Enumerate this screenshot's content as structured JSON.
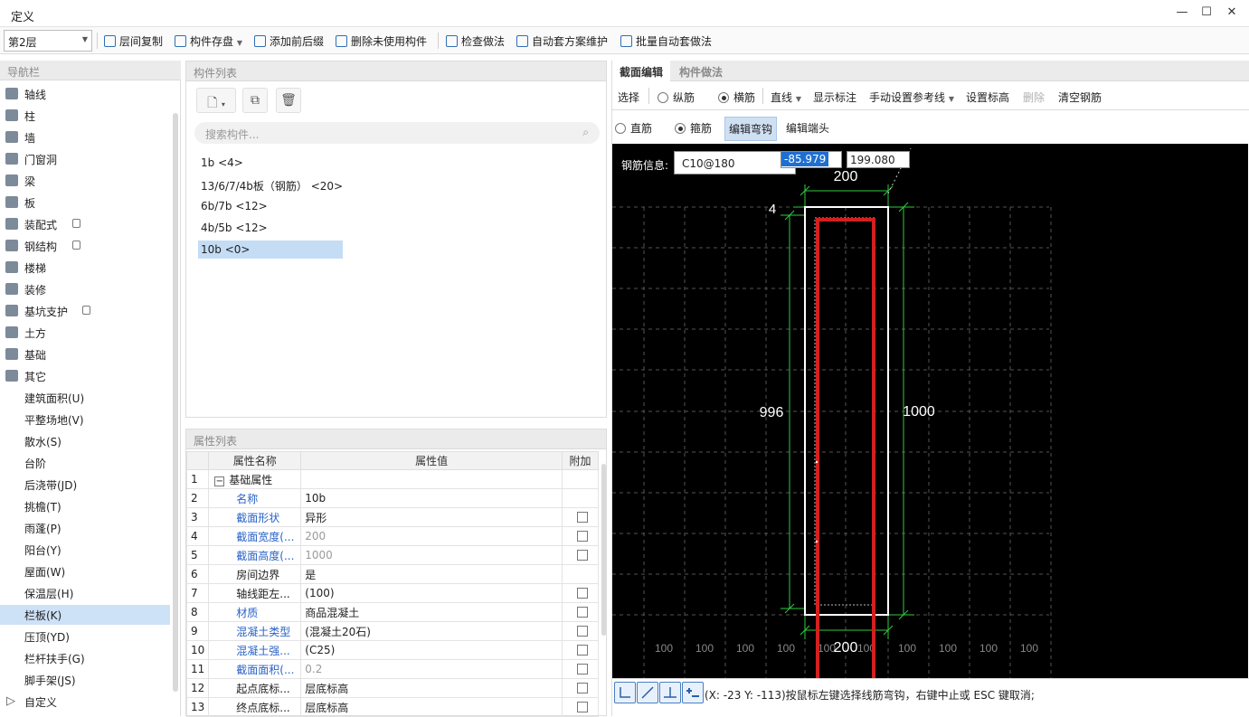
{
  "window": {
    "title": "定义"
  },
  "toolbar": {
    "floor": "第2层",
    "items": [
      "层间复制",
      "构件存盘",
      "添加前后缀",
      "删除未使用构件",
      "检查做法",
      "自动套方案维护",
      "批量自动套做法"
    ]
  },
  "nav": {
    "title": "导航栏",
    "items": [
      "轴线",
      "柱",
      "墙",
      "门窗洞",
      "梁",
      "板",
      "装配式",
      "钢结构",
      "楼梯",
      "装修",
      "基坑支护",
      "土方",
      "基础",
      "其它"
    ],
    "subitems": [
      "建筑面积(U)",
      "平整场地(V)",
      "散水(S)",
      "台阶",
      "后浇带(JD)",
      "挑檐(T)",
      "雨蓬(P)",
      "阳台(Y)",
      "屋面(W)",
      "保温层(H)",
      "栏板(K)",
      "压顶(YD)",
      "栏杆扶手(G)",
      "脚手架(JS)"
    ],
    "last": "自定义"
  },
  "components": {
    "title": "构件列表",
    "search_placeholder": "搜索构件...",
    "items": [
      "1b <4>",
      "13/6/7/4b板（钢筋） <20>",
      "6b/7b <12>",
      "4b/5b <12>",
      "10b <0>"
    ]
  },
  "props": {
    "title": "属性列表",
    "headers": [
      "属性名称",
      "属性值",
      "附加"
    ],
    "rows": [
      {
        "n": "1",
        "name": "基础属性",
        "value": ""
      },
      {
        "n": "2",
        "name": "名称",
        "value": "10b"
      },
      {
        "n": "3",
        "name": "截面形状",
        "value": "异形"
      },
      {
        "n": "4",
        "name": "截面宽度(...",
        "value": "200"
      },
      {
        "n": "5",
        "name": "截面高度(...",
        "value": "1000"
      },
      {
        "n": "6",
        "name": "房间边界",
        "value": "是"
      },
      {
        "n": "7",
        "name": "轴线距左...",
        "value": "(100)"
      },
      {
        "n": "8",
        "name": "材质",
        "value": "商品混凝土"
      },
      {
        "n": "9",
        "name": "混凝土类型",
        "value": "(混凝土20石)"
      },
      {
        "n": "10",
        "name": "混凝土强...",
        "value": "(C25)"
      },
      {
        "n": "11",
        "name": "截面面积(...",
        "value": "0.2"
      },
      {
        "n": "12",
        "name": "起点底标...",
        "value": "层底标高"
      },
      {
        "n": "13",
        "name": "终点底标...",
        "value": "层底标高"
      }
    ]
  },
  "right": {
    "tabs": [
      "截面编辑",
      "构件做法"
    ],
    "row1": {
      "select": "选择",
      "zong": "纵筋",
      "heng": "横筋",
      "line": "直线",
      "show": "显示标注",
      "manual": "手动设置参考线",
      "elev": "设置标高",
      "del": "删除",
      "clear": "清空钢筋"
    },
    "row2": {
      "zhi": "直筋",
      "gu": "箍筋",
      "edit_hook": "编辑弯钩",
      "edit_end": "编辑端头"
    }
  },
  "canvas": {
    "rebar_label": "钢筋信息:",
    "rebar_value": "C10@180",
    "coord_x": "-85.979",
    "coord_y": "199.080",
    "dim_top": "200",
    "dim_bottom": "200",
    "dim_left": "996",
    "dim_right": "1000",
    "dim_corner": "4",
    "grid_label": "100"
  },
  "status": {
    "text": "(X: -23 Y: -113)按鼠标左键选择线筋弯钩，右键中止或 ESC 键取消;"
  }
}
